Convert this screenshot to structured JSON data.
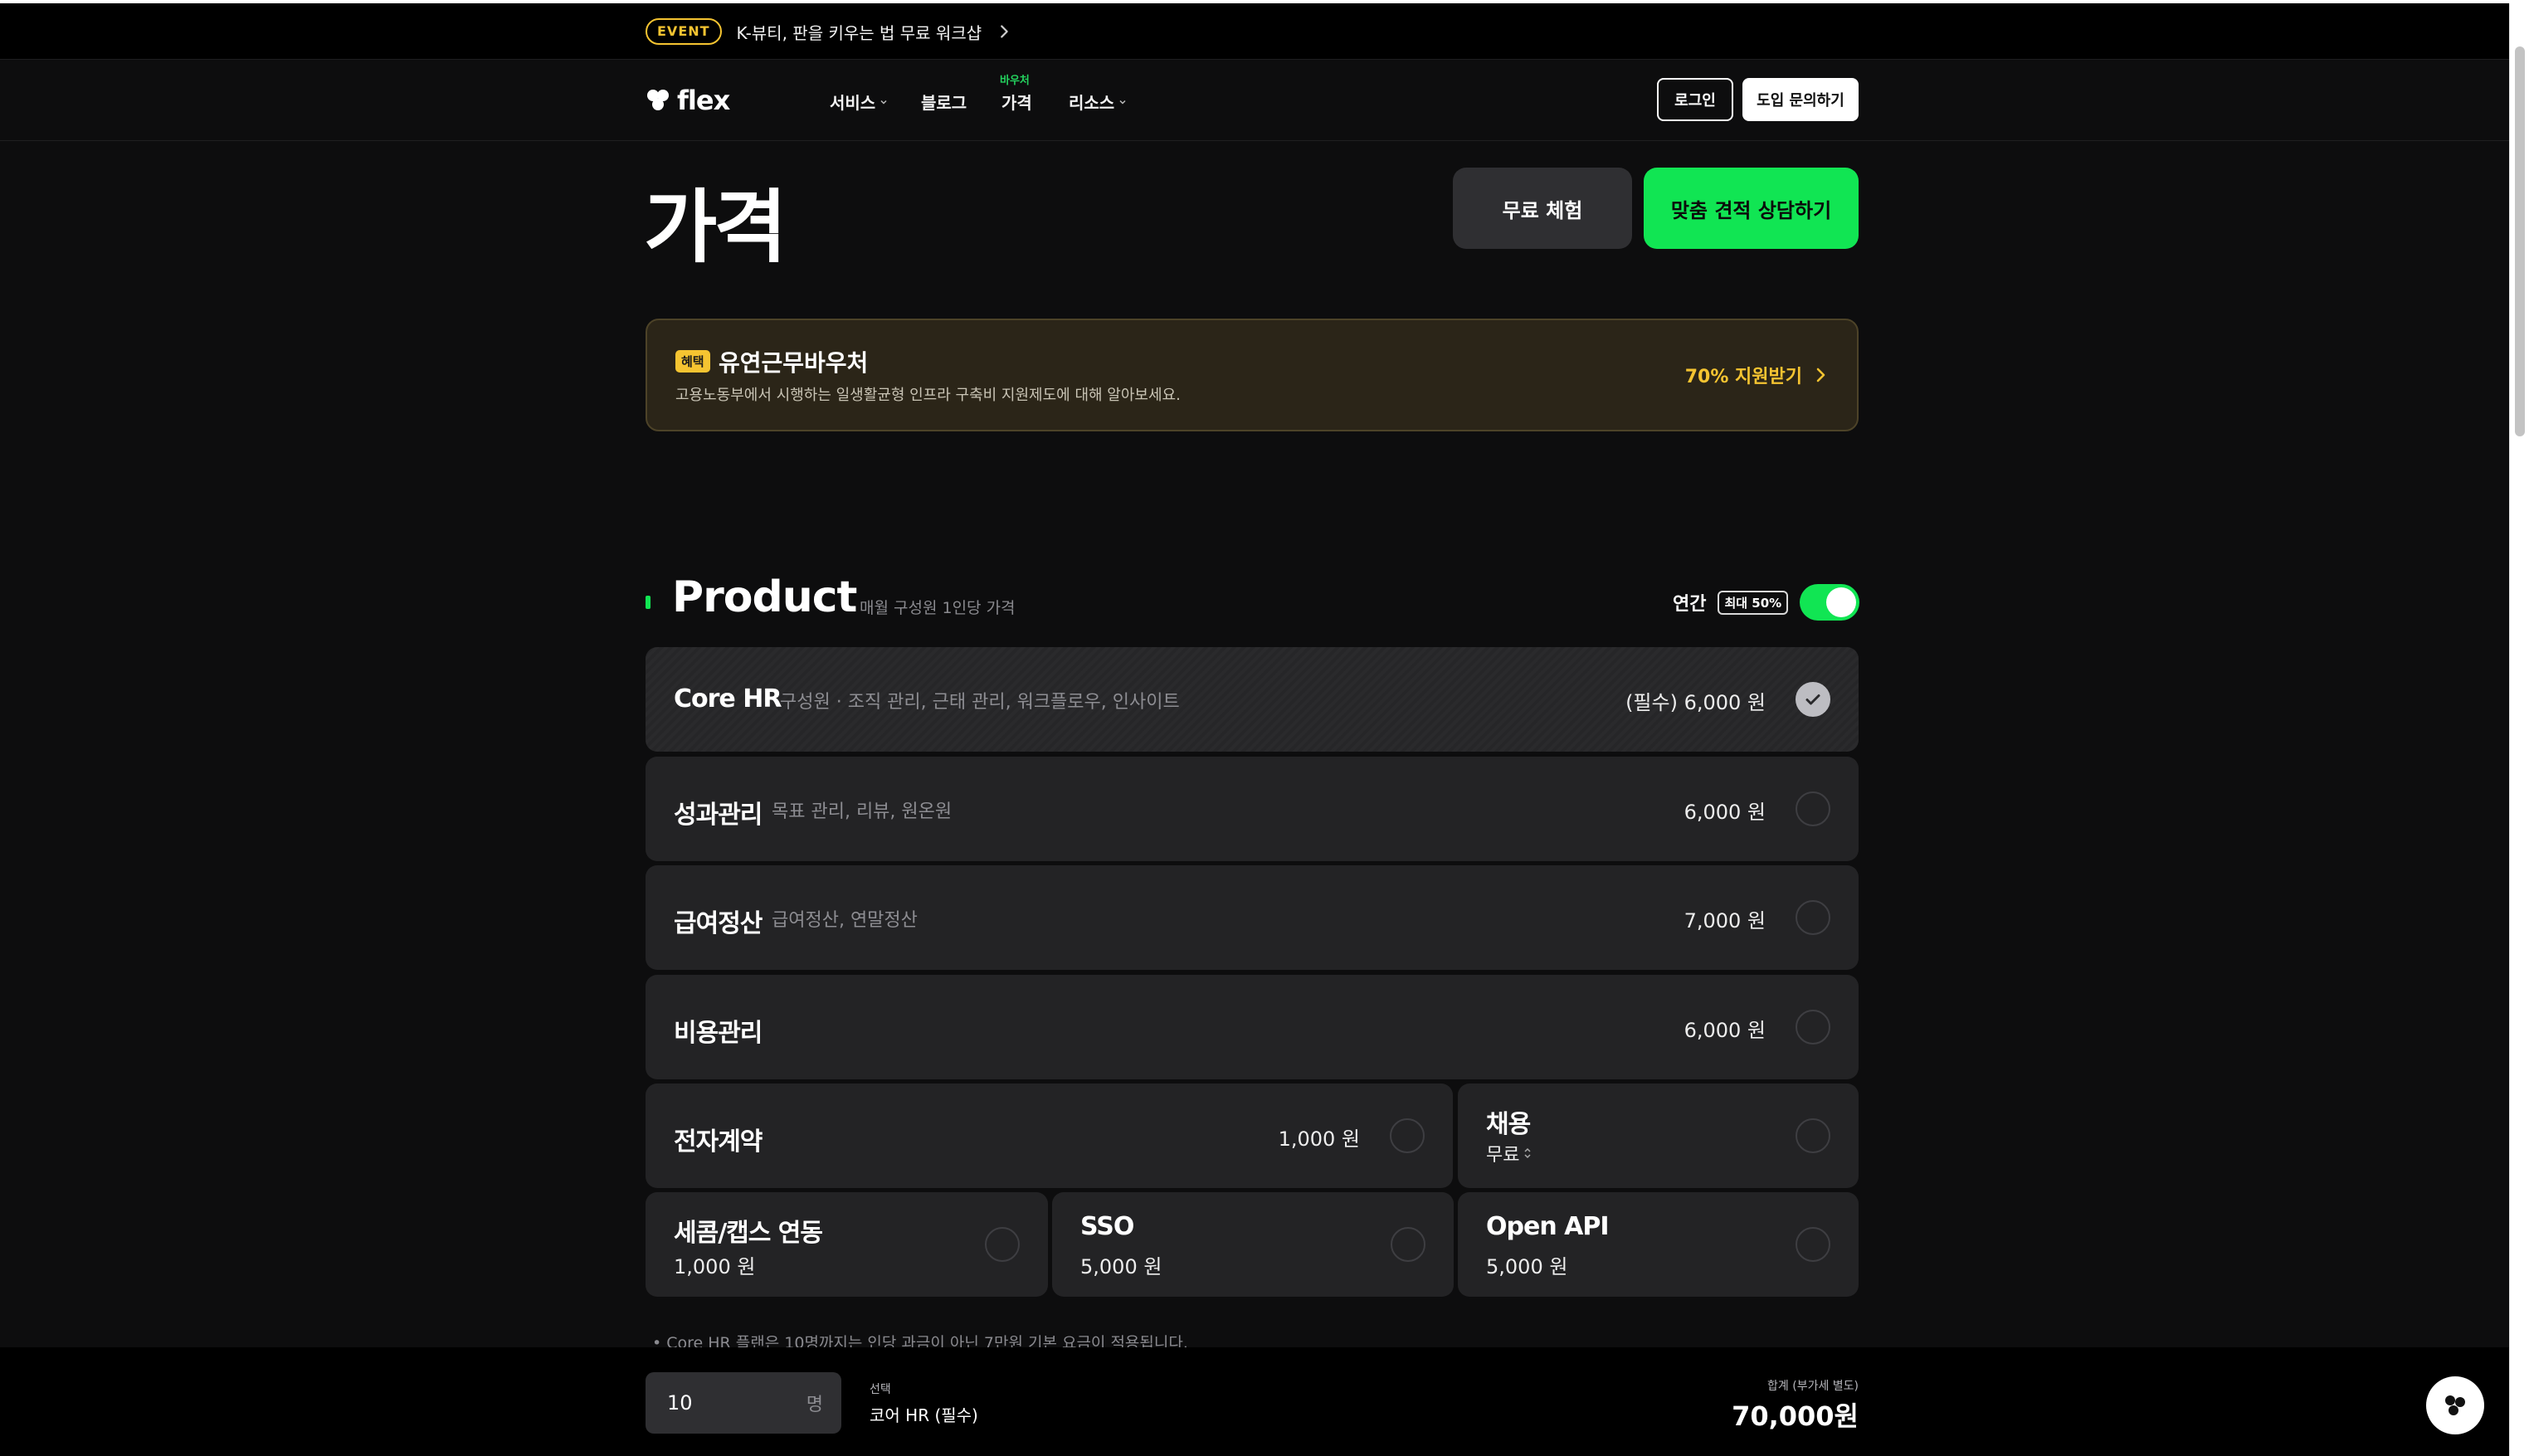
{
  "event": {
    "badge": "EVENT",
    "text": "K-뷰티, 판을 키우는 법 무료 워크샵"
  },
  "nav": {
    "logo_text": "flex",
    "items": [
      {
        "label": "서비스",
        "has_dropdown": true
      },
      {
        "label": "블로그",
        "has_dropdown": false
      },
      {
        "label": "가격",
        "has_dropdown": false,
        "badge": "바우처"
      },
      {
        "label": "리소스",
        "has_dropdown": true
      }
    ],
    "login": "로그인",
    "inquiry": "도입 문의하기"
  },
  "page": {
    "title": "가격",
    "trial_button": "무료 체험",
    "quote_button": "맞춤 견적 상담하기"
  },
  "voucher": {
    "badge": "혜택",
    "title": "유연근무바우처",
    "desc": "고용노동부에서 시행하는 일생활균형 인프라 구축비 지원제도에 대해 알아보세요.",
    "cta": "70% 지원받기"
  },
  "product": {
    "title": "Product",
    "subtitle": "매월 구성원 1인당 가격",
    "billing_label": "연간",
    "billing_badge": "최대 50%",
    "annual_enabled": true,
    "rows": [
      {
        "name": "Core HR",
        "desc": "구성원 · 조직 관리, 근태 관리, 워크플로우, 인사이트",
        "price": "(필수) 6,000 원",
        "selected": true
      },
      {
        "name": "성과관리",
        "desc": "목표 관리, 리뷰, 원온원",
        "price": "6,000 원",
        "selected": false
      },
      {
        "name": "급여정산",
        "desc": "급여정산, 연말정산",
        "price": "7,000 원",
        "selected": false
      },
      {
        "name": "비용관리",
        "desc": "",
        "price": "6,000 원",
        "selected": false
      }
    ],
    "contract": {
      "name": "전자계약",
      "price": "1,000 원",
      "selected": false
    },
    "hiring": {
      "name": "채용",
      "option": "무료",
      "selected": false
    },
    "addons": [
      {
        "name": "세콤/캡스 연동",
        "price": "1,000 원",
        "selected": false
      },
      {
        "name": "SSO",
        "price": "5,000 원",
        "selected": false
      },
      {
        "name": "Open API",
        "price": "5,000 원",
        "selected": false
      }
    ],
    "footnote": "Core HR 플랜은 10명까지는 인당 과금이 아닌 7만원 기본 요금이 적용됩니다."
  },
  "summary": {
    "people_value": "10",
    "people_unit": "명",
    "selected_label": "선택",
    "selected_value": "코어 HR (필수)",
    "total_label": "합계 (부가세 별도)",
    "total_value": "70,000원"
  },
  "colors": {
    "accent_green": "#11e553",
    "voucher_yellow": "#f5c431",
    "background": "#0d0d0e",
    "card": "#232325"
  }
}
